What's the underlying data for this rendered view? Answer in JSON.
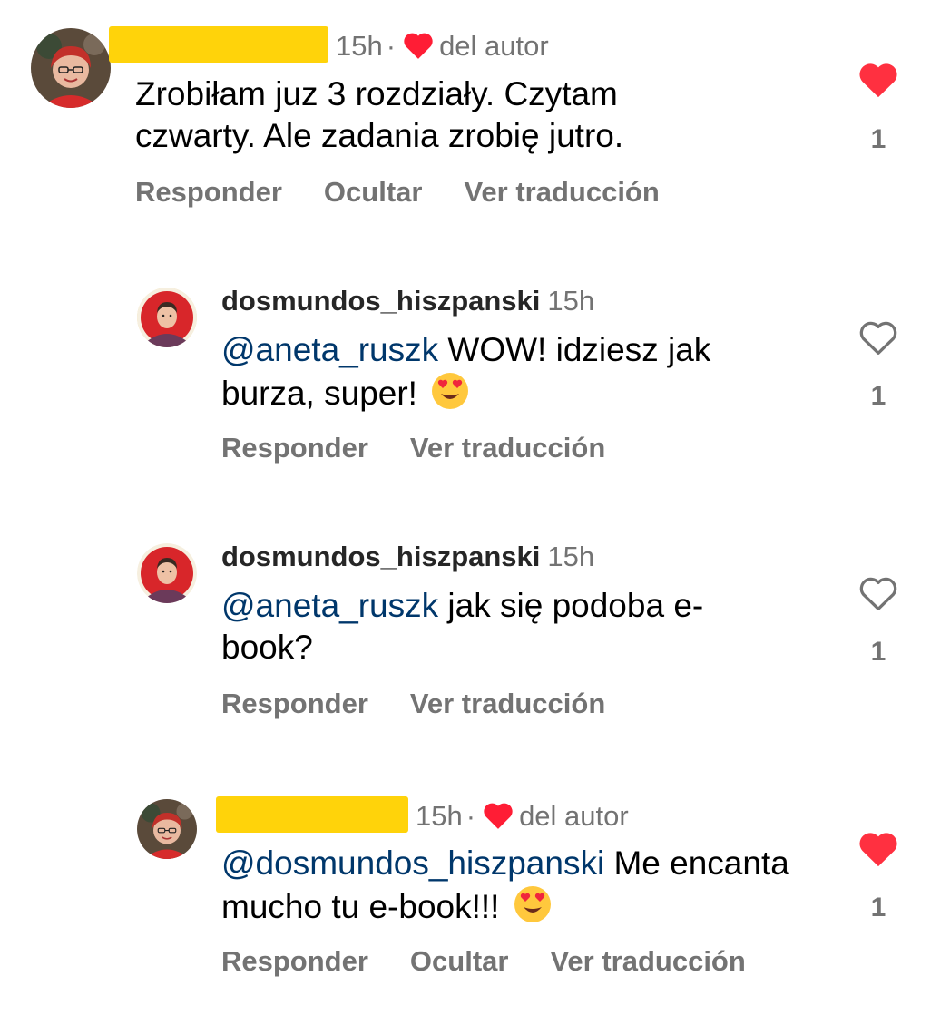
{
  "comments": [
    {
      "username": "",
      "time": "15h",
      "author_liked_label": "del autor",
      "mention": "",
      "text": "Zrobiłam juz 3 rozdziały. Czytam czwarty. Ale zadania zrobię jutro.",
      "actions": [
        "Responder",
        "Ocultar",
        "Ver traducción"
      ],
      "liked": true,
      "like_count": "1"
    },
    {
      "username": "dosmundos_hiszpanski",
      "time": "15h",
      "mention": "@aneta_ruszk",
      "text": "WOW! idziesz jak burza, super!",
      "emoji": "heart-eyes-emoji",
      "actions": [
        "Responder",
        "Ver traducción"
      ],
      "liked": false,
      "like_count": "1"
    },
    {
      "username": "dosmundos_hiszpanski",
      "time": "15h",
      "mention": "@aneta_ruszk",
      "text": "jak się podoba e-book?",
      "actions": [
        "Responder",
        "Ver traducción"
      ],
      "liked": false,
      "like_count": "1"
    },
    {
      "username": "",
      "time": "15h",
      "author_liked_label": "del autor",
      "mention": "@dosmundos_hiszpanski",
      "text": "Me encanta mucho tu e-book!!!",
      "emoji": "heart-eyes-emoji",
      "actions": [
        "Responder",
        "Ocultar",
        "Ver traducción"
      ],
      "liked": true,
      "like_count": "1"
    }
  ],
  "colors": {
    "like_red": "#ff3040",
    "secondary_text": "#737373",
    "mention_blue": "#00376b",
    "redaction_yellow": "#ffd30a"
  },
  "icons": {
    "liked": "filled-heart-icon",
    "unliked": "outline-heart-icon",
    "author_like": "small-heart-icon"
  }
}
